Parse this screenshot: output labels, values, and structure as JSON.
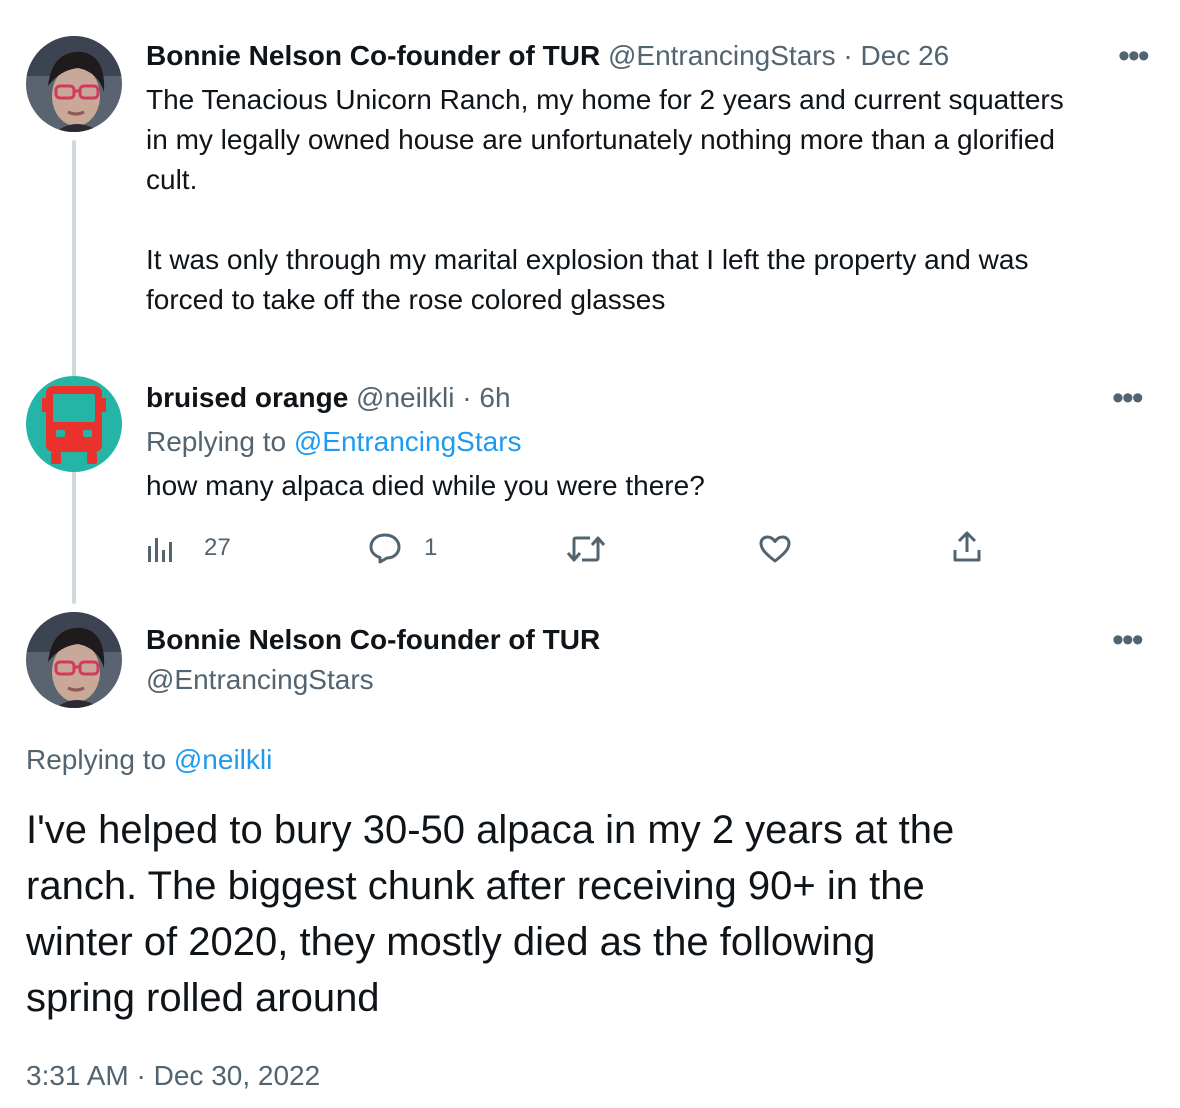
{
  "tweet1": {
    "display_name": "Bonnie Nelson Co-founder of TUR",
    "handle": "@EntrancingStars",
    "separator": "·",
    "date": "Dec 26",
    "more": "•••",
    "text_lines": [
      "The Tenacious Unicorn Ranch, my home for 2 years and current squatters",
      "in my legally owned house are unfortunately nothing more than a glorified",
      "cult.",
      "It was only through my marital explosion that I left the property and was",
      "forced to take off the rose colored glasses"
    ]
  },
  "tweet2": {
    "display_name": "bruised orange",
    "handle": "@neilkli",
    "separator": "·",
    "time": "6h",
    "more": "•••",
    "replying_prefix": "Replying to",
    "replying_to": "@EntrancingStars",
    "text": "how many alpaca died while you were there?",
    "actions": {
      "views_icon": "views-icon",
      "views_count": "27",
      "reply_icon": "reply-icon",
      "reply_count": "1",
      "retweet_icon": "retweet-icon",
      "like_icon": "like-icon",
      "share_icon": "share-icon"
    }
  },
  "tweet3": {
    "display_name": "Bonnie Nelson Co-founder of TUR",
    "handle": "@EntrancingStars",
    "more": "•••",
    "replying_prefix": "Replying to",
    "replying_to": "@neilkli",
    "text_lines": [
      "I've helped to bury 30-50 alpaca in my 2 years at the",
      "ranch. The biggest chunk after receiving 90+ in the",
      "winter of 2020, they mostly died as the following",
      "spring rolled around"
    ],
    "time": "3:31 AM",
    "separator": "·",
    "date": "Dec 30, 2022"
  },
  "colors": {
    "text": "#0f1419",
    "muted": "#536471",
    "link": "#1d9bf0",
    "thread_line": "#cfd9de",
    "bus_avatar_bg": "#24b5a6",
    "bus_red": "#e8322b"
  }
}
